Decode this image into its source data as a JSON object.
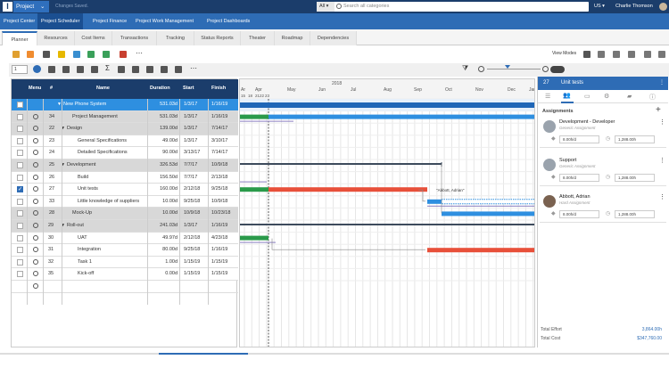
{
  "topbar": {
    "app_menu": "Project",
    "status": "Changes Saved.",
    "search_scope": "All",
    "search_placeholder": "Search all categories",
    "locale": "US",
    "user": "Charlie Thomson"
  },
  "module_tabs": [
    "Project Center",
    "Project Scheduler",
    "Project Finance",
    "Project Work Management",
    "Project Dashboards"
  ],
  "sub_tabs": [
    "Planner",
    "Resources",
    "Cost Items",
    "Transactions",
    "Tracking",
    "Status Reports",
    "Theater",
    "Roadmap",
    "Dependencies"
  ],
  "toolbar": {
    "view_modes": "View Modes",
    "level": "1"
  },
  "grid": {
    "headers": {
      "menu": "Menu",
      "num": "#",
      "name": "Name",
      "duration": "Duration",
      "start": "Start",
      "finish": "Finish"
    },
    "rows": [
      {
        "num": "",
        "name": "New Phone System",
        "duration": "531.03d",
        "start": "1/3/17",
        "finish": "1/16/19"
      },
      {
        "num": "34",
        "name": "Project Management",
        "duration": "531.03d",
        "start": "1/3/17",
        "finish": "1/16/19"
      },
      {
        "num": "22",
        "name": "Design",
        "duration": "139.00d",
        "start": "1/3/17",
        "finish": "7/14/17"
      },
      {
        "num": "23",
        "name": "General Specifications",
        "duration": "49.00d",
        "start": "1/3/17",
        "finish": "3/10/17"
      },
      {
        "num": "24",
        "name": "Detailed Specifications",
        "duration": "90.00d",
        "start": "3/13/17",
        "finish": "7/14/17"
      },
      {
        "num": "25",
        "name": "Development",
        "duration": "326.53d",
        "start": "7/7/17",
        "finish": "10/9/18"
      },
      {
        "num": "26",
        "name": "Build",
        "duration": "156.50d",
        "start": "7/7/17",
        "finish": "2/13/18"
      },
      {
        "num": "27",
        "name": "Unit tests",
        "duration": "160.00d",
        "start": "2/12/18",
        "finish": "9/25/18"
      },
      {
        "num": "33",
        "name": "Little knowledge of suppliers",
        "duration": "10.00d",
        "start": "9/25/18",
        "finish": "10/9/18"
      },
      {
        "num": "28",
        "name": "Mock-Up",
        "duration": "10.00d",
        "start": "10/9/18",
        "finish": "10/23/18"
      },
      {
        "num": "29",
        "name": "Roll-out",
        "duration": "241.03d",
        "start": "1/3/17",
        "finish": "1/16/19"
      },
      {
        "num": "30",
        "name": "UAT",
        "duration": "49.97d",
        "start": "2/12/18",
        "finish": "4/23/18"
      },
      {
        "num": "31",
        "name": "Integration",
        "duration": "80.00d",
        "start": "9/25/18",
        "finish": "1/16/19"
      },
      {
        "num": "32",
        "name": "Task 1",
        "duration": "1.00d",
        "start": "1/15/19",
        "finish": "1/15/19"
      },
      {
        "num": "35",
        "name": "Kick-off",
        "duration": "0.00d",
        "start": "1/15/19",
        "finish": "1/15/19"
      }
    ]
  },
  "gantt": {
    "year": "2018",
    "months": [
      "Apr",
      "May",
      "Jun",
      "Jul",
      "Aug",
      "Sep",
      "Oct",
      "Nov",
      "Dec",
      "Jan"
    ],
    "pre_months": [
      "Ar"
    ],
    "days": [
      "15",
      "18",
      "21",
      "22",
      "23"
    ],
    "assignee_label": "\"Abbott, Adrian\""
  },
  "panel": {
    "count": "27",
    "title": "Unit tests",
    "section": "Assignments",
    "assignments": [
      {
        "name": "Development - Developer",
        "role": "Generic Assignment",
        "effort": "8.00h/d",
        "cost": "1,288.00h"
      },
      {
        "name": "Support",
        "role": "Generic Assignment",
        "effort": "8.00h/d",
        "cost": "1,288.00h"
      },
      {
        "name": "Abbott, Adrian",
        "role": "Hard Assignment",
        "effort": "8.00h/d",
        "cost": "1,288.00h"
      }
    ],
    "total_effort_label": "Total Effort",
    "total_effort": "3,864.00h",
    "total_cost_label": "Total Cost",
    "total_cost": "$347,760.00"
  },
  "colors": {
    "navy": "#1b3d6b",
    "blue": "#2e6cb5",
    "green": "#2a9a4a",
    "red": "#e8503a",
    "gray_bar": "#3d4b5c"
  }
}
